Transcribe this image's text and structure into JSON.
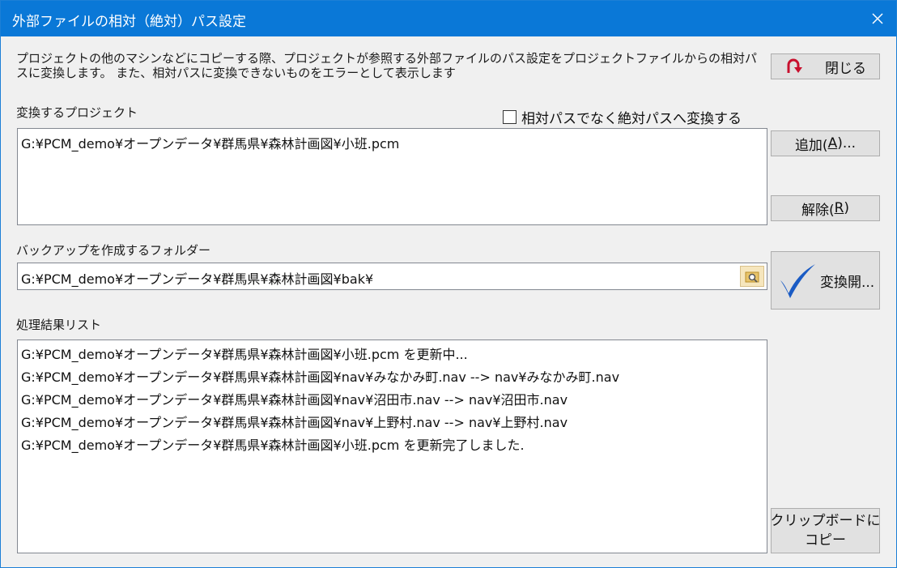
{
  "window": {
    "title": "外部ファイルの相対（絶対）パス設定",
    "close_icon": "close-icon"
  },
  "description": "プロジェクトの他のマシンなどにコピーする際、プロジェクトが参照する外部ファイルのパス設定をプロジェクトファイルからの相対パスに変換します。 また、相対パスに変換できないものをエラーとして表示します",
  "buttons": {
    "close_label": "閉じる",
    "add_label": "追加(",
    "add_key": "A",
    "add_suffix": ")...",
    "remove_label": "解除(",
    "remove_key": "R",
    "remove_suffix": ")",
    "start_label": "変換開...",
    "clipboard_line1": "クリップボードに",
    "clipboard_line2": "コピー"
  },
  "projects": {
    "label": "変換するプロジェクト",
    "absolute_checkbox_label": "相対パスでなく絶対パスへ変換する",
    "absolute_checked": false,
    "items": [
      "G:¥PCM_demo¥オープンデータ¥群馬県¥森林計画図¥小班.pcm"
    ]
  },
  "backup": {
    "label": "バックアップを作成するフォルダー",
    "value": "G:¥PCM_demo¥オープンデータ¥群馬県¥森林計画図¥bak¥"
  },
  "results": {
    "label": "処理結果リスト",
    "lines": [
      "G:¥PCM_demo¥オープンデータ¥群馬県¥森林計画図¥小班.pcm を更新中...",
      "G:¥PCM_demo¥オープンデータ¥群馬県¥森林計画図¥nav¥みなかみ町.nav --> nav¥みなかみ町.nav",
      "G:¥PCM_demo¥オープンデータ¥群馬県¥森林計画図¥nav¥沼田市.nav --> nav¥沼田市.nav",
      "G:¥PCM_demo¥オープンデータ¥群馬県¥森林計画図¥nav¥上野村.nav --> nav¥上野村.nav",
      "G:¥PCM_demo¥オープンデータ¥群馬県¥森林計画図¥小班.pcm を更新完了しました."
    ]
  },
  "colors": {
    "titlebar": "#0a78d7",
    "close_button_icon": "#c8102e",
    "checkmark": "#1a5bc4"
  }
}
